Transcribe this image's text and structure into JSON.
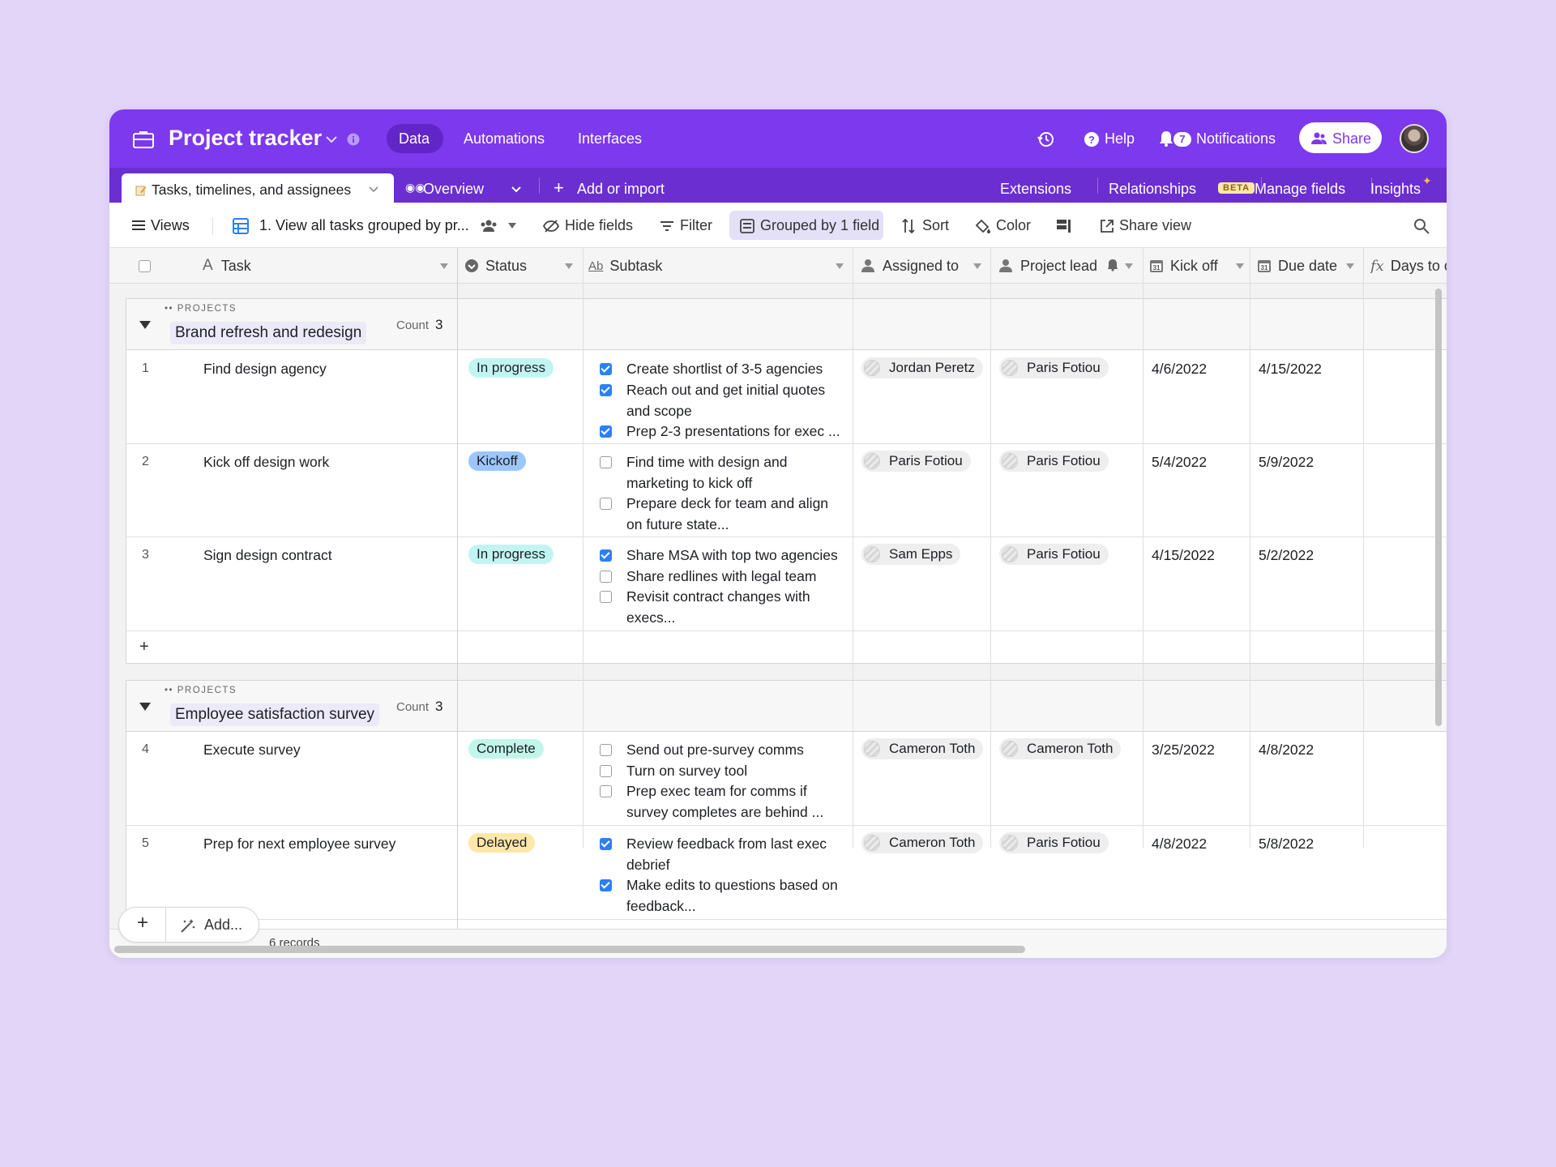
{
  "app": {
    "title": "Project tracker",
    "nav": [
      "Data",
      "Automations",
      "Interfaces"
    ],
    "help": "Help",
    "notifications_count": "7",
    "notifications": "Notifications",
    "share": "Share"
  },
  "tabs": {
    "table_tab": "Tasks, timelines, and assignees",
    "overview": "Overview",
    "add_import": "Add or import",
    "extensions": "Extensions",
    "relationships": "Relationships",
    "beta": "BETA",
    "manage_fields": "Manage fields",
    "insights": "Insights"
  },
  "toolbar": {
    "views": "Views",
    "view_name": "1. View all tasks grouped by pr...",
    "hide_fields": "Hide fields",
    "filter": "Filter",
    "grouped": "Grouped by 1 field",
    "sort": "Sort",
    "color": "Color",
    "share_view": "Share view"
  },
  "columns": {
    "task": "Task",
    "status": "Status",
    "subtask": "Subtask",
    "assigned": "Assigned to",
    "lead": "Project lead",
    "kickoff": "Kick off",
    "due": "Due date",
    "days": "Days to c"
  },
  "groups": [
    {
      "label": "PROJECTS",
      "name": "Brand refresh and redesign",
      "count_label": "Count",
      "count": "3",
      "rows": [
        {
          "num": "1",
          "task": "Find design agency",
          "status": "In progress",
          "subs": [
            "Create shortlist of 3-5 agencies",
            "Reach out and get initial quotes and scope",
            "Prep 2-3 presentations for exec ..."
          ],
          "assigned": "Jordan Peretz",
          "lead": "Paris Fotiou",
          "kickoff": "4/6/2022",
          "due": "4/15/2022"
        },
        {
          "num": "2",
          "task": "Kick off design work",
          "status": "Kickoff",
          "subs": [
            "Find time with design and marketing to kick off",
            "Prepare deck for team and align on future state..."
          ],
          "assigned": "Paris Fotiou",
          "lead": "Paris Fotiou",
          "kickoff": "5/4/2022",
          "due": "5/9/2022"
        },
        {
          "num": "3",
          "task": "Sign design contract",
          "status": "In progress",
          "subs": [
            "Share MSA with top two agencies",
            "Share redlines with legal team",
            "Revisit contract changes with execs..."
          ],
          "assigned": "Sam Epps",
          "lead": "Paris Fotiou",
          "kickoff": "4/15/2022",
          "due": "5/2/2022"
        }
      ]
    },
    {
      "label": "PROJECTS",
      "name": "Employee satisfaction survey",
      "count_label": "Count",
      "count": "3",
      "rows": [
        {
          "num": "4",
          "task": "Execute survey",
          "status": "Complete",
          "subs": [
            "Send out pre-survey comms",
            "Turn on survey tool",
            "Prep exec team for comms if survey completes are behind ..."
          ],
          "assigned": "Cameron Toth",
          "lead": "Cameron Toth",
          "kickoff": "3/25/2022",
          "due": "4/8/2022"
        },
        {
          "num": "5",
          "task": "Prep for next employee survey",
          "status": "Delayed",
          "subs": [
            "Review feedback from last exec debrief",
            "Make edits to questions based on feedback..."
          ],
          "assigned": "Cameron Toth",
          "lead": "Paris Fotiou",
          "kickoff": "4/8/2022",
          "due": "5/8/2022"
        }
      ]
    }
  ],
  "footer": {
    "add": "Add...",
    "records": "6 records",
    "add_row": "+"
  },
  "colors": {
    "topbar": "#7c39ed",
    "tabbar": "#6a2ed1",
    "in_progress": "#c2f5f2",
    "kickoff": "#9cc6ff",
    "complete": "#c2f5e9",
    "delayed": "#ffe7a8",
    "checkbox": "#2d7ff9"
  }
}
